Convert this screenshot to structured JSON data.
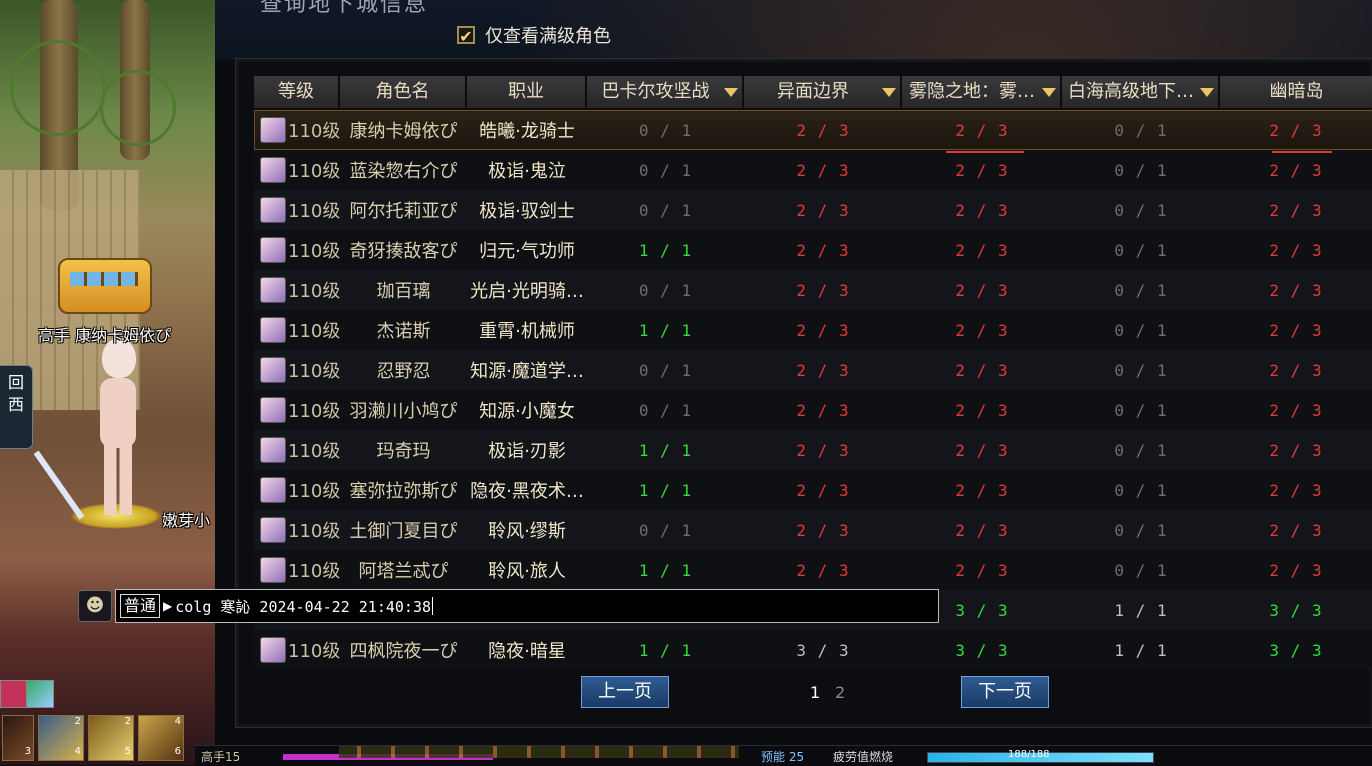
{
  "window": {
    "title": "查询地下城信息"
  },
  "filter": {
    "checked": true,
    "label": "仅查看满级角色"
  },
  "table": {
    "headers": {
      "level": "等级",
      "name": "角色名",
      "job": "职业",
      "d1": "巴卡尔攻坚战",
      "d2": "异面边界",
      "d3": "雾隐之地：雾…",
      "d4": "白海高级地下…",
      "d5": "幽暗岛"
    },
    "rows": [
      {
        "level": "110级",
        "name": "康纳卡姆依ぴ",
        "job": "皓曦·龙骑士",
        "d1": "0 / 1",
        "d2": "2 / 3",
        "d3": "2 / 3",
        "d4": "0 / 1",
        "d5": "2 / 3"
      },
      {
        "level": "110级",
        "name": "蓝染惣右介ぴ",
        "job": "极诣·鬼泣",
        "d1": "0 / 1",
        "d2": "2 / 3",
        "d3": "2 / 3",
        "d4": "0 / 1",
        "d5": "2 / 3"
      },
      {
        "level": "110级",
        "name": "阿尔托莉亚ぴ",
        "job": "极诣·驭剑士",
        "d1": "0 / 1",
        "d2": "2 / 3",
        "d3": "2 / 3",
        "d4": "0 / 1",
        "d5": "2 / 3"
      },
      {
        "level": "110级",
        "name": "奇犽揍敌客ぴ",
        "job": "归元·气功师",
        "d1": "1 / 1",
        "d2": "2 / 3",
        "d3": "2 / 3",
        "d4": "0 / 1",
        "d5": "2 / 3"
      },
      {
        "level": "110级",
        "name": "珈百璃",
        "job": "光启·光明骑…",
        "d1": "0 / 1",
        "d2": "2 / 3",
        "d3": "2 / 3",
        "d4": "0 / 1",
        "d5": "2 / 3"
      },
      {
        "level": "110级",
        "name": "杰诺斯",
        "job": "重霄·机械师",
        "d1": "1 / 1",
        "d2": "2 / 3",
        "d3": "2 / 3",
        "d4": "0 / 1",
        "d5": "2 / 3"
      },
      {
        "level": "110级",
        "name": "忍野忍",
        "job": "知源·魔道学…",
        "d1": "0 / 1",
        "d2": "2 / 3",
        "d3": "2 / 3",
        "d4": "0 / 1",
        "d5": "2 / 3"
      },
      {
        "level": "110级",
        "name": "羽濑川小鸠ぴ",
        "job": "知源·小魔女",
        "d1": "0 / 1",
        "d2": "2 / 3",
        "d3": "2 / 3",
        "d4": "0 / 1",
        "d5": "2 / 3"
      },
      {
        "level": "110级",
        "name": "玛奇玛",
        "job": "极诣·刃影",
        "d1": "1 / 1",
        "d2": "2 / 3",
        "d3": "2 / 3",
        "d4": "0 / 1",
        "d5": "2 / 3"
      },
      {
        "level": "110级",
        "name": "塞弥拉弥斯ぴ",
        "job": "隐夜·黑夜术…",
        "d1": "1 / 1",
        "d2": "2 / 3",
        "d3": "2 / 3",
        "d4": "0 / 1",
        "d5": "2 / 3"
      },
      {
        "level": "110级",
        "name": "土御门夏目ぴ",
        "job": "聆风·缪斯",
        "d1": "0 / 1",
        "d2": "2 / 3",
        "d3": "2 / 3",
        "d4": "0 / 1",
        "d5": "2 / 3"
      },
      {
        "level": "110级",
        "name": "阿塔兰忒ぴ",
        "job": "聆风·旅人",
        "d1": "1 / 1",
        "d2": "2 / 3",
        "d3": "2 / 3",
        "d4": "0 / 1",
        "d5": "2 / 3"
      },
      {
        "level": "",
        "name": "",
        "job": "",
        "d1": "",
        "d2": "",
        "d3": "3 / 3",
        "d4": "1 / 1",
        "d5": "3 / 3"
      },
      {
        "level": "110级",
        "name": "四枫院夜一ぴ",
        "job": "隐夜·暗星",
        "d1": "1 / 1",
        "d2": "3 / 3",
        "d3": "3 / 3",
        "d4": "1 / 1",
        "d5": "3 / 3"
      }
    ]
  },
  "pagination": {
    "prev_label": "上一页",
    "next_label": "下一页",
    "current_page": "1",
    "other_page": "2"
  },
  "chat": {
    "channel": "普通",
    "text": "colg 寒訫 2024-04-22 21:40:38"
  },
  "scene": {
    "player_title": "高手",
    "player_name": "康纳卡姆依ぴ",
    "npc_name": "嫩芽小",
    "side_panel_line1": "回",
    "side_panel_line2": "西",
    "skill_counts": [
      "2",
      "2",
      "4"
    ],
    "skill_sub_counts": [
      "3",
      "4",
      "5",
      "6"
    ]
  },
  "status_bar": {
    "level_text": "高手15",
    "sp_text": "预能 25",
    "fatigue_text": "疲劳值燃烧",
    "hp_text": "188/188"
  },
  "colors": {
    "red": "#e0393a",
    "green": "#2fdc3a",
    "gray": "#6e6e70",
    "button_blue": "#2e5c93",
    "header_gold": "#e8c866"
  }
}
